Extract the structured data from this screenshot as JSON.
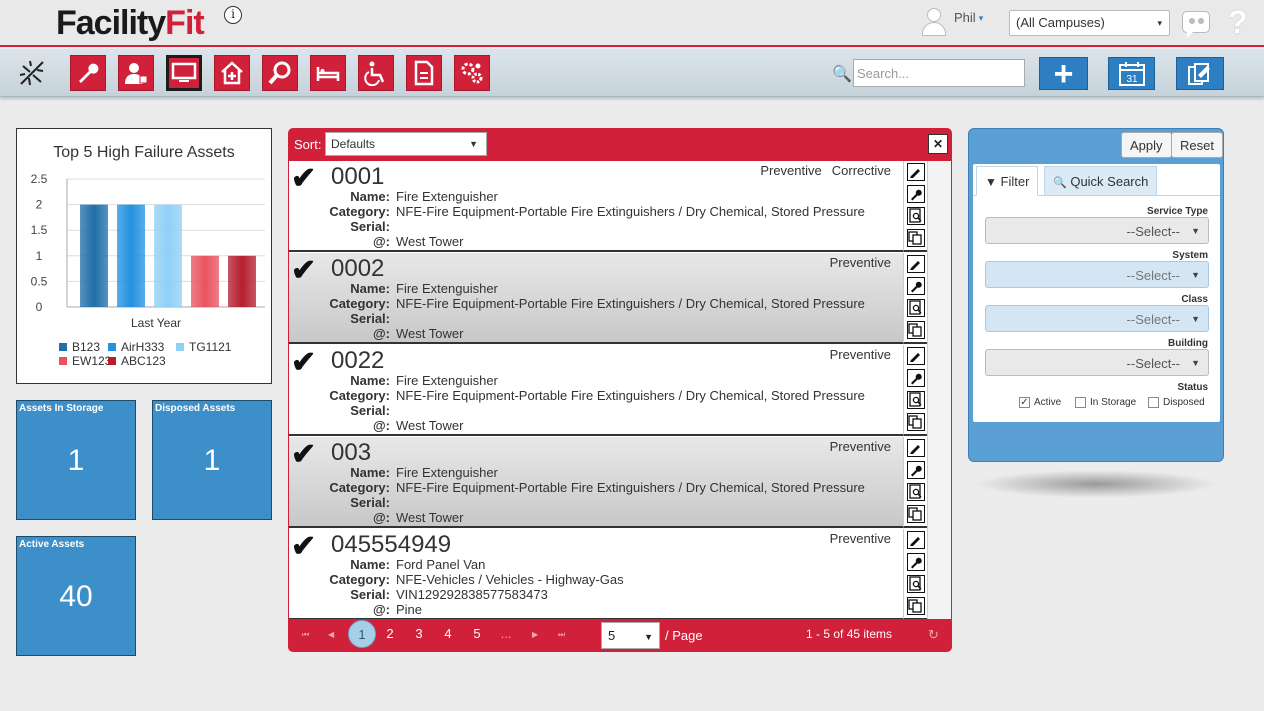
{
  "app": {
    "logo_main": "Facility",
    "logo_accent": "Fit",
    "info_glyph": "i"
  },
  "user": {
    "name": "Phil",
    "caret": "▾"
  },
  "campus": {
    "selected": "(All Campuses)",
    "caret": "▾"
  },
  "help": {
    "glyph": "?"
  },
  "search": {
    "placeholder": "Search...",
    "icon": "search-icon",
    "glyph": "🔍"
  },
  "toolbar": {
    "nav": [
      "wrench-icon",
      "user-icon",
      "monitor-icon",
      "home-plus-icon",
      "magnifier-icon",
      "bed-icon",
      "wheelchair-icon",
      "document-icon",
      "gears-icon"
    ],
    "active_index": 2,
    "new_glyph": "+",
    "calendar_day": "31"
  },
  "chart_data": {
    "type": "bar",
    "title": "Top 5 High Failure Assets",
    "categories": [
      "Last Year"
    ],
    "series": [
      {
        "name": "B123",
        "values": [
          2
        ],
        "color": "#1f6fa8"
      },
      {
        "name": "AirH333",
        "values": [
          2
        ],
        "color": "#2291e0"
      },
      {
        "name": "TG1121",
        "values": [
          2
        ],
        "color": "#8fd0f5"
      },
      {
        "name": "EW123",
        "values": [
          1
        ],
        "color": "#e8535f"
      },
      {
        "name": "ABC123",
        "values": [
          1
        ],
        "color": "#b51e2e"
      }
    ],
    "ylim": [
      0,
      2.5
    ],
    "yticks": [
      "0",
      "0.5",
      "1",
      "1.5",
      "2",
      "2.5"
    ],
    "grid": true,
    "legend": "bottom"
  },
  "tiles": {
    "storage": {
      "label": "Assets In Storage",
      "value": "1"
    },
    "disposed": {
      "label": "Disposed Assets",
      "value": "1"
    },
    "active": {
      "label": "Active Assets",
      "value": "40"
    }
  },
  "list": {
    "sort_label": "Sort:",
    "sort_value": "Defaults",
    "clear_glyph": "✕",
    "field_labels": {
      "name": "Name:",
      "category": "Category:",
      "serial": "Serial:",
      "location": "@:"
    },
    "rows": [
      {
        "code": "0001",
        "tags": [
          "Preventive",
          "Corrective"
        ],
        "name": "Fire Extenguisher",
        "category": "NFE-Fire Equipment-Portable Fire Extinguishers / Dry Chemical, Stored Pressure",
        "serial": "",
        "location": "West Tower"
      },
      {
        "code": "0002",
        "tags": [
          "Preventive"
        ],
        "name": "Fire Extenguisher",
        "category": "NFE-Fire Equipment-Portable Fire Extinguishers / Dry Chemical, Stored Pressure",
        "serial": "",
        "location": "West Tower"
      },
      {
        "code": "0022",
        "tags": [
          "Preventive"
        ],
        "name": "Fire Extenguisher",
        "category": "NFE-Fire Equipment-Portable Fire Extinguishers / Dry Chemical, Stored Pressure",
        "serial": "",
        "location": "West Tower"
      },
      {
        "code": "003",
        "tags": [
          "Preventive"
        ],
        "name": "Fire Extenguisher",
        "category": "NFE-Fire Equipment-Portable Fire Extinguishers / Dry Chemical, Stored Pressure",
        "serial": "",
        "location": "West Tower"
      },
      {
        "code": "045554949",
        "tags": [
          "Preventive"
        ],
        "name": "Ford Panel Van",
        "category": "NFE-Vehicles / Vehicles - Highway-Gas",
        "serial": "VIN129292838577583473",
        "location": "Pine"
      }
    ],
    "row_actions": [
      "edit-icon",
      "wrench-icon",
      "inspect-icon",
      "copy-icon"
    ],
    "check_glyph": "✔"
  },
  "pager": {
    "first": "⏮",
    "prev": "◀",
    "next": "▶",
    "last": "⏭",
    "pages": [
      "1",
      "2",
      "3",
      "4",
      "5",
      "..."
    ],
    "current": "1",
    "per_page": "5",
    "per_page_label": "/ Page",
    "items_text": "1 - 5 of 45 items",
    "refresh_glyph": "↻"
  },
  "filter": {
    "apply": "Apply",
    "reset": "Reset",
    "tab_filter": "Filter",
    "tab_quick": "Quick Search",
    "fields": [
      {
        "label": "Service Type",
        "value": "--Select--"
      },
      {
        "label": "System",
        "value": "--Select--"
      },
      {
        "label": "Class",
        "value": "--Select--"
      },
      {
        "label": "Building",
        "value": "--Select--"
      }
    ],
    "status_label": "Status",
    "statuses": [
      {
        "label": "Active",
        "checked": true
      },
      {
        "label": "In Storage",
        "checked": false
      },
      {
        "label": "Disposed",
        "checked": false
      }
    ]
  }
}
